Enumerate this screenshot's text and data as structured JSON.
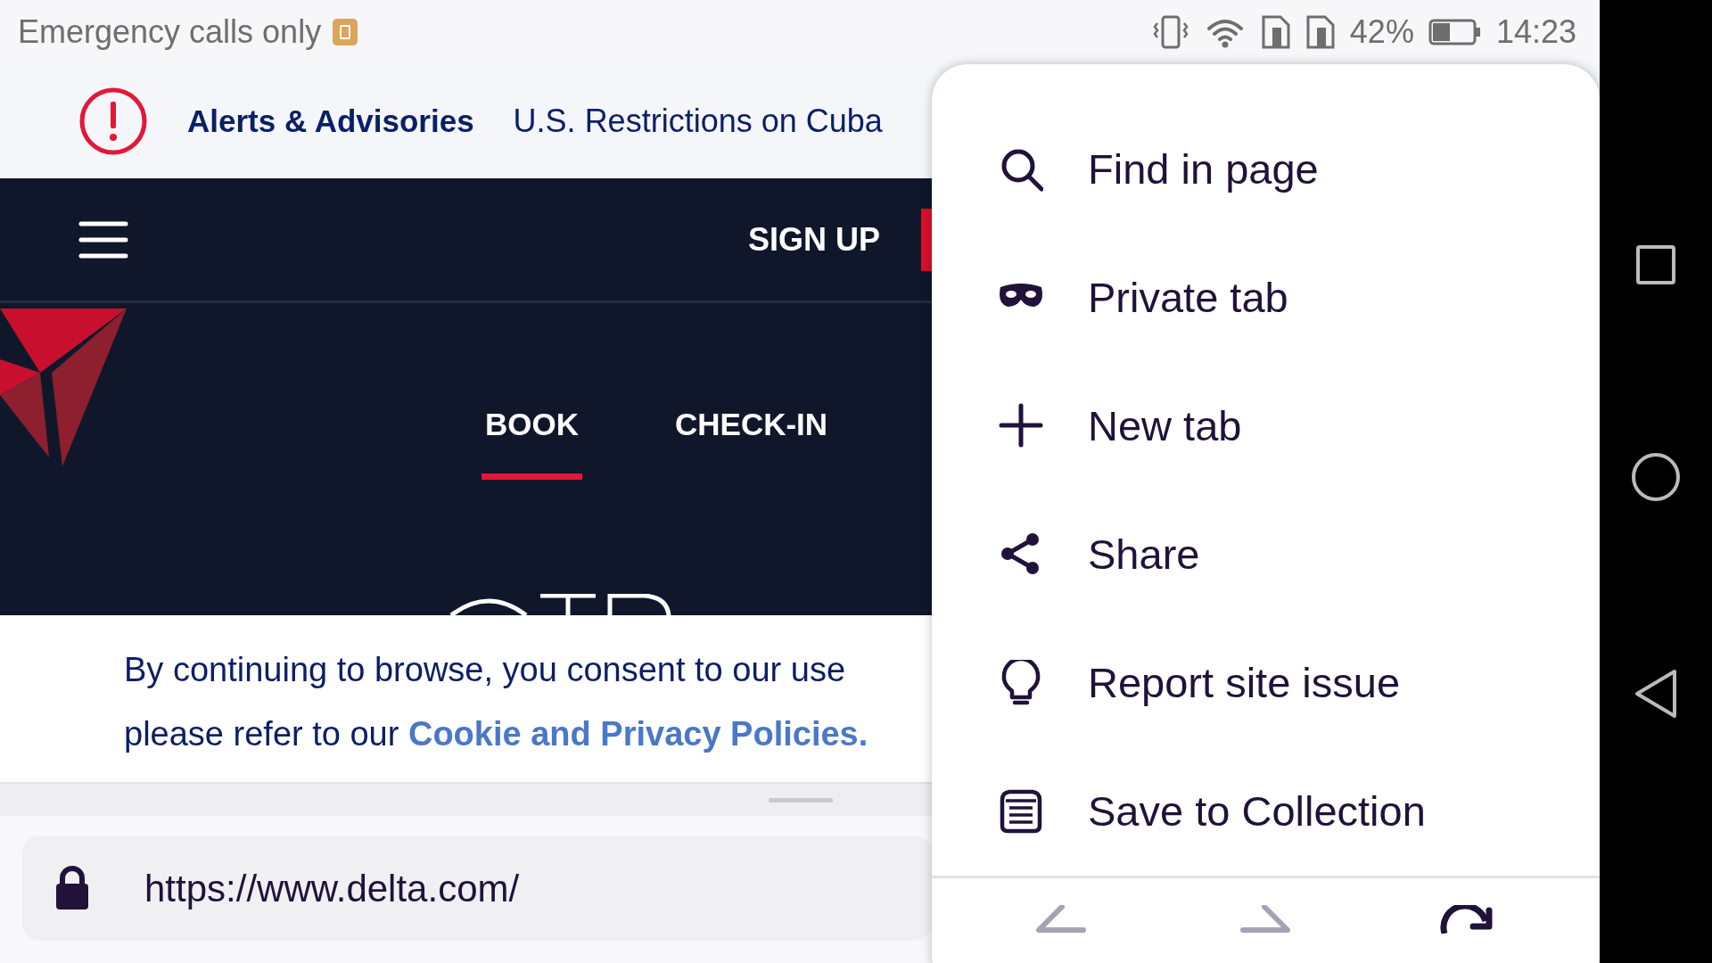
{
  "status_bar": {
    "carrier_text": "Emergency calls only",
    "battery_percent": "42%",
    "time": "14:23"
  },
  "alert_bar": {
    "title": "Alerts & Advisories",
    "message": "U.S. Restrictions on Cuba"
  },
  "header": {
    "sign_up": "SIGN UP",
    "tabs": [
      {
        "label": "BOOK",
        "selected": true
      },
      {
        "label": "CHECK-IN",
        "selected": false
      }
    ]
  },
  "cookie_banner": {
    "line_1": "By continuing to browse, you consent to our use",
    "line_2": "please refer to our",
    "link": "Cookie and Privacy Policies."
  },
  "url_bar": {
    "url": "https://www.delta.com/"
  },
  "menu": {
    "items": [
      {
        "label": "Find in page",
        "kind": "search"
      },
      {
        "label": "Private tab",
        "kind": "mask"
      },
      {
        "label": "New tab",
        "kind": "plus"
      },
      {
        "label": "Share",
        "kind": "share"
      },
      {
        "label": "Report site issue",
        "kind": "bulb"
      },
      {
        "label": "Save to Collection",
        "kind": "collection"
      }
    ],
    "nav": [
      {
        "kind": "back",
        "disabled": true
      },
      {
        "kind": "forward",
        "disabled": true
      },
      {
        "kind": "reload",
        "disabled": false
      }
    ]
  }
}
